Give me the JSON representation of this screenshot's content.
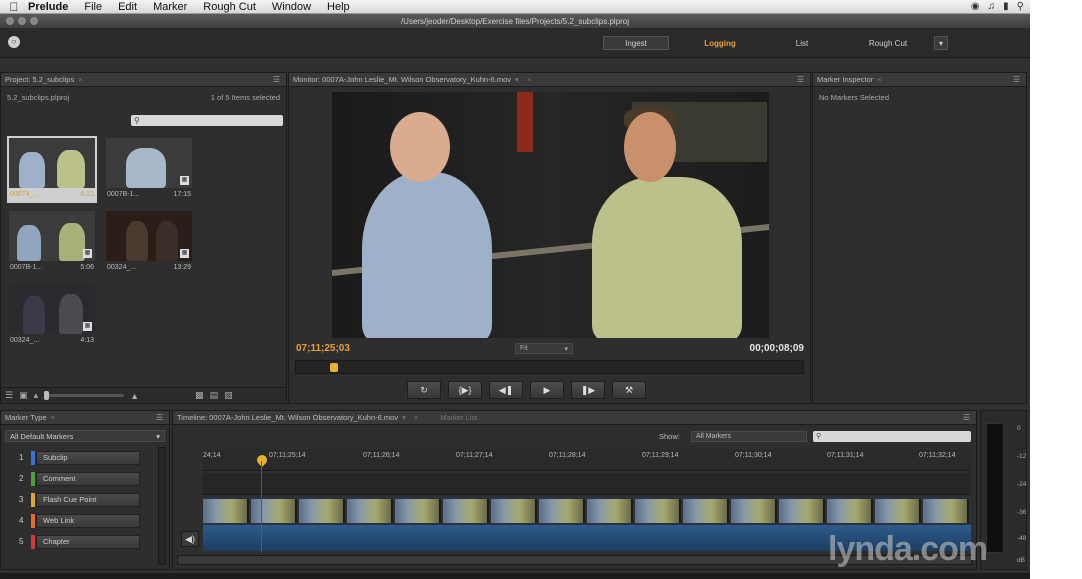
{
  "menubar": {
    "app": "Prelude",
    "items": [
      "File",
      "Edit",
      "Marker",
      "Rough Cut",
      "Window",
      "Help"
    ]
  },
  "window": {
    "title": "/Users/jeoder/Desktop/Exercise files/Projects/5.2_subclips.plproj"
  },
  "workspaces": {
    "ingest": "Ingest",
    "logging": "Logging",
    "list": "List",
    "rough_cut": "Rough Cut"
  },
  "project": {
    "tab": "Project: 5.2_subclips",
    "file": "5.2_subclips.plproj",
    "count": "1 of 5 Items selected",
    "thumbs": [
      {
        "name": "00074_...",
        "dur": "6:22"
      },
      {
        "name": "0007B-1...",
        "dur": "17:15"
      },
      {
        "name": "0007B-1...",
        "dur": "5:06"
      },
      {
        "name": "00324_...",
        "dur": "13:29"
      },
      {
        "name": "00324_...",
        "dur": "4:13"
      }
    ]
  },
  "monitor": {
    "tab": "Monitor: 0007A-John Leslie_Mt. Wilson Observatory_Kuhn-6.mov",
    "timecode_current": "07;11;25;03",
    "timecode_duration": "00;00;08;09",
    "fit": "Fit"
  },
  "inspector": {
    "tab": "Marker Inspector",
    "empty": "No Markers Selected"
  },
  "marker_type": {
    "tab": "Marker Type",
    "filter": "All Default Markers",
    "items": [
      {
        "num": "1",
        "label": "Subclip",
        "color": "#3b6fd6"
      },
      {
        "num": "2",
        "label": "Comment",
        "color": "#49a13a"
      },
      {
        "num": "3",
        "label": "Flash Cue Point",
        "color": "#e0a52c"
      },
      {
        "num": "4",
        "label": "Web Link",
        "color": "#e3692c"
      },
      {
        "num": "5",
        "label": "Chapter",
        "color": "#d23a3a"
      }
    ]
  },
  "timeline": {
    "tab": "Timeline: 0007A-John Leslie_Mt. Wilson Observatory_Kuhn-6.mov",
    "tab2": "Marker List",
    "show_label": "Show:",
    "show_value": "All Markers",
    "ticks": [
      "24;14",
      "07;11;25;14",
      "07;11;26;14",
      "07;11;27;14",
      "07;11;28;14",
      "07;11;29;14",
      "07;11;30;14",
      "07;11;31;14",
      "07;11;32;14"
    ]
  },
  "meter": {
    "labels": [
      "0",
      "-12",
      "-24",
      "-36",
      "-48",
      "dB"
    ]
  },
  "watermark": "lynda.com"
}
